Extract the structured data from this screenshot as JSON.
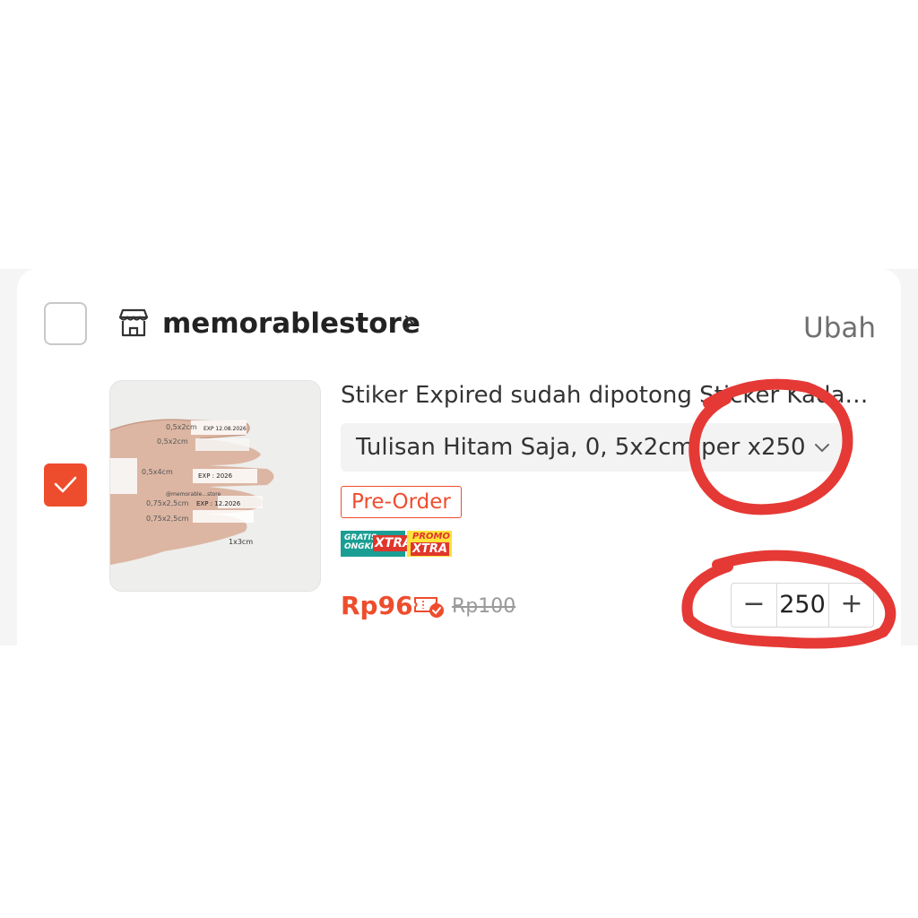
{
  "shop": {
    "name": "memorablestore",
    "edit_label": "Ubah",
    "selected": false
  },
  "item": {
    "selected": true,
    "title": "Stiker Expired sudah dipotong Sticker Kadaluarsa",
    "variant": "Tulisan Hitam Saja, 0, 5x2cm per x250",
    "preorder_label": "Pre-Order",
    "badges": {
      "shipping_line1": "GRATIS",
      "shipping_line2": "ONGKIR",
      "shipping_tag": "XTRA",
      "promo_line1": "PROMO",
      "promo_tag": "XTRA"
    },
    "price": "Rp96",
    "original_price": "Rp100",
    "quantity": "250",
    "image_labels": {
      "l1": "0,5x2cm",
      "l2": "EXP 12.08.2026",
      "l3": "0,5x2cm",
      "l4": "0,5x4cm",
      "l5": "EXP : 2026",
      "l6": "@memorable...store",
      "l7": "0,75x2,5cm",
      "l8": "EXP : 12.2026",
      "l9": "0,75x2,5cm",
      "l10": "1x3cm"
    }
  },
  "icons": {
    "store": "store-icon",
    "chevron": "chevron-right-icon",
    "dropdown": "chevron-down-icon",
    "voucher": "voucher-icon",
    "check": "check-icon"
  },
  "colors": {
    "accent": "#ee4d2d",
    "annotation": "#e53935"
  }
}
